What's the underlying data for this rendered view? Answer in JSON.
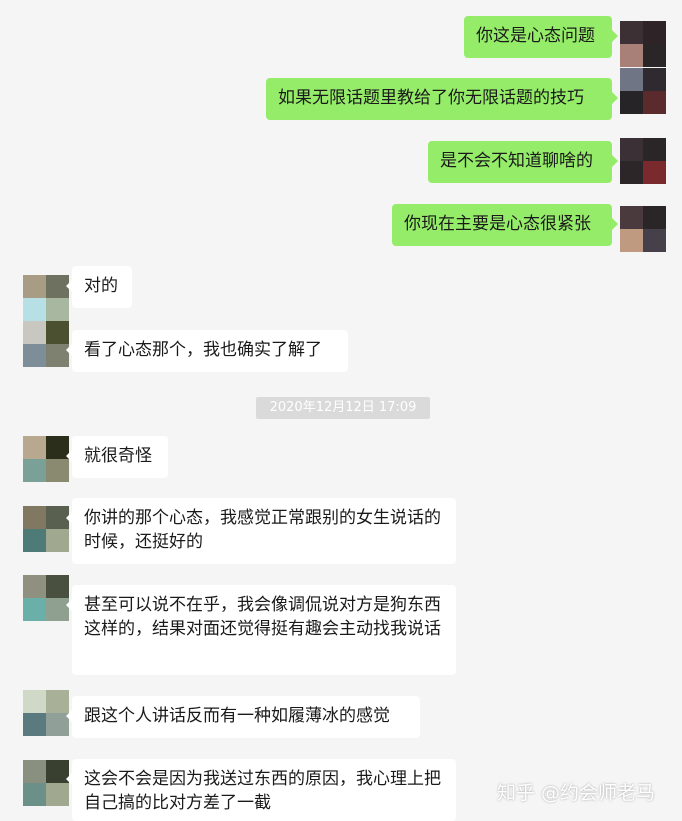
{
  "messages_right": [
    "你这是心态问题",
    "如果无限话题里教给了你无限话题的技巧",
    "是不会不知道聊啥的",
    "你现在主要是心态很紧张"
  ],
  "messages_left": [
    "对的",
    "看了心态那个，我也确实了解了",
    "就很奇怪",
    "你讲的那个心态，我感觉正常跟别的女生说话的时候，还挺好的",
    "甚至可以说不在乎，我会像调侃说对方是狗东西这样的，结果对面还觉得挺有趣会主动找我说话",
    "跟这个人讲话反而有一种如履薄冰的感觉",
    "这会不会是因为我送过东西的原因，我心理上把自己搞的比对方差了一截"
  ],
  "timestamp": "2020年12月12日 17:09",
  "watermark": "知乎 @约会师老马",
  "colors": {
    "bubble_self": "#95ec69",
    "bubble_other": "#ffffff",
    "background": "#f5f5f5"
  }
}
